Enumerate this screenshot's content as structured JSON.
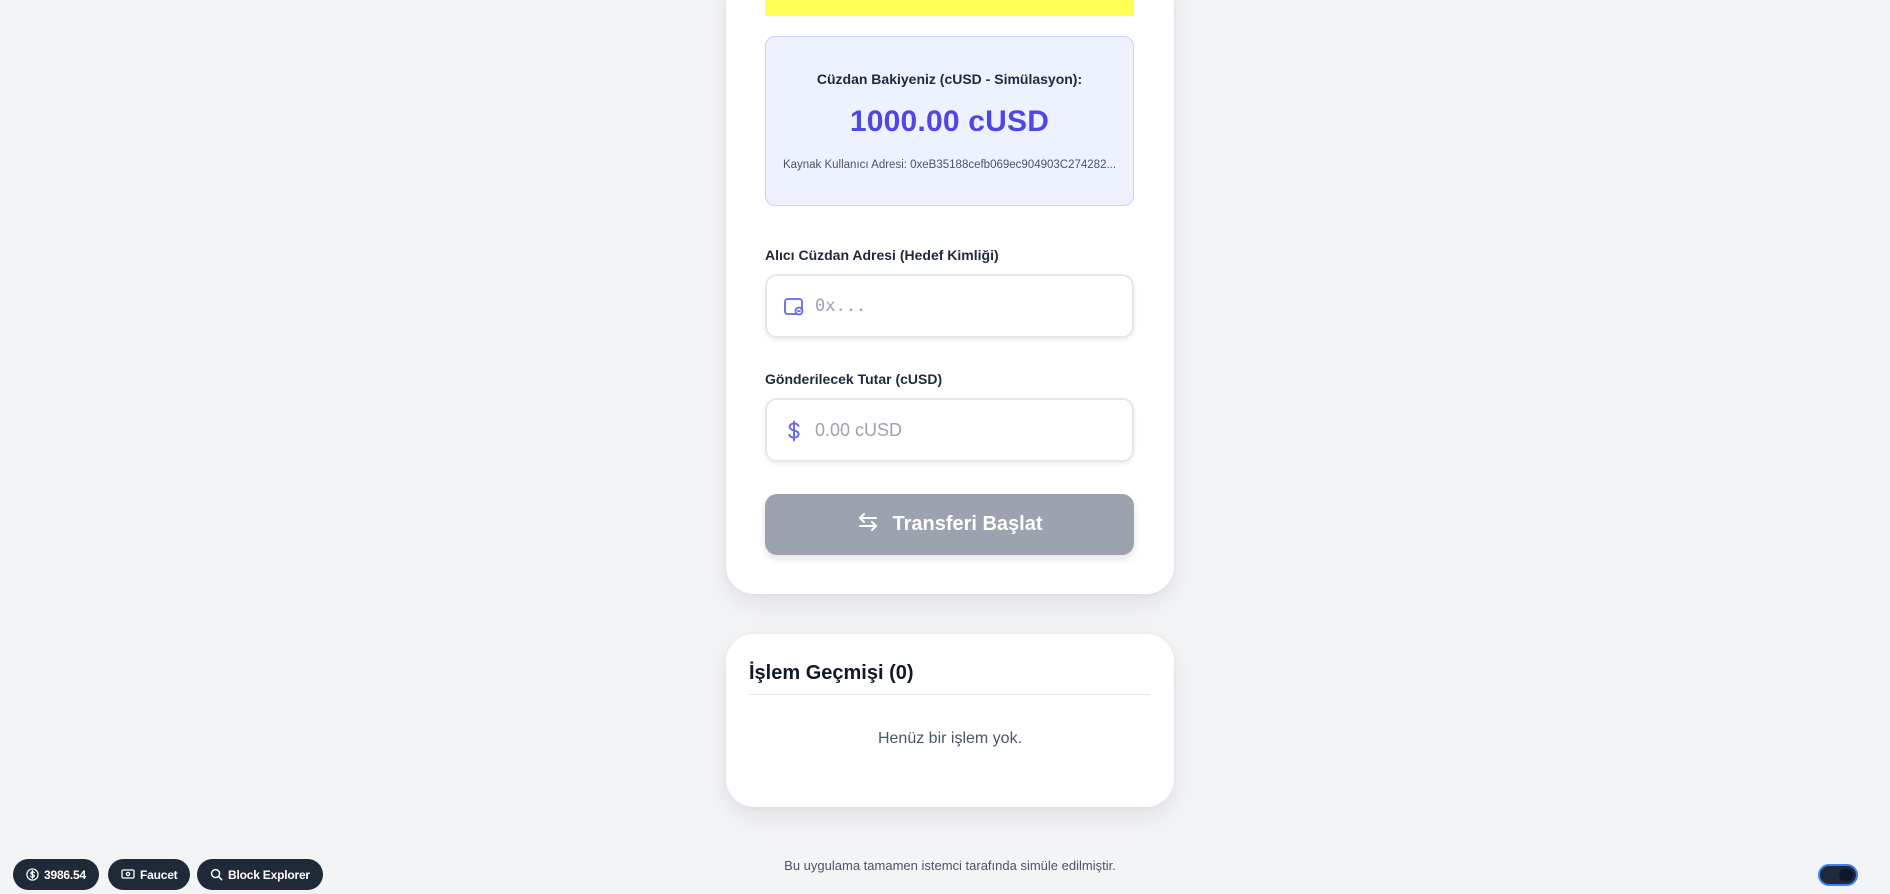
{
  "balance": {
    "title": "Cüzdan Bakiyeniz (cUSD - Simülasyon):",
    "value": "1000.00 cUSD",
    "source_address": "Kaynak Kullanıcı Adresi: 0xeB35188cefb069ec904903C274282..."
  },
  "recipient": {
    "label": "Alıcı Cüzdan Adresi (Hedef Kimliği)",
    "placeholder": "0x...",
    "icon": "wallet-icon"
  },
  "amount": {
    "label": "Gönderilecek Tutar (cUSD)",
    "placeholder": "0.00 cUSD",
    "icon": "dollar-icon"
  },
  "transfer_button": {
    "label": "Transferi Başlat",
    "icon": "arrows-exchange-icon"
  },
  "history": {
    "title": "İşlem Geçmişi (0)",
    "empty_message": "Henüz bir işlem yok."
  },
  "footer": {
    "text": "Bu uygulama tamamen istemci tarafında simüle edilmiştir."
  },
  "dev_toolbar": {
    "balance": "3986.54",
    "faucet_label": "Faucet",
    "explorer_label": "Block Explorer"
  },
  "colors": {
    "accent": "#4f46e5",
    "warning": "#ffff56",
    "button_disabled": "#9ca3af",
    "pill_bg": "#1f2937"
  }
}
